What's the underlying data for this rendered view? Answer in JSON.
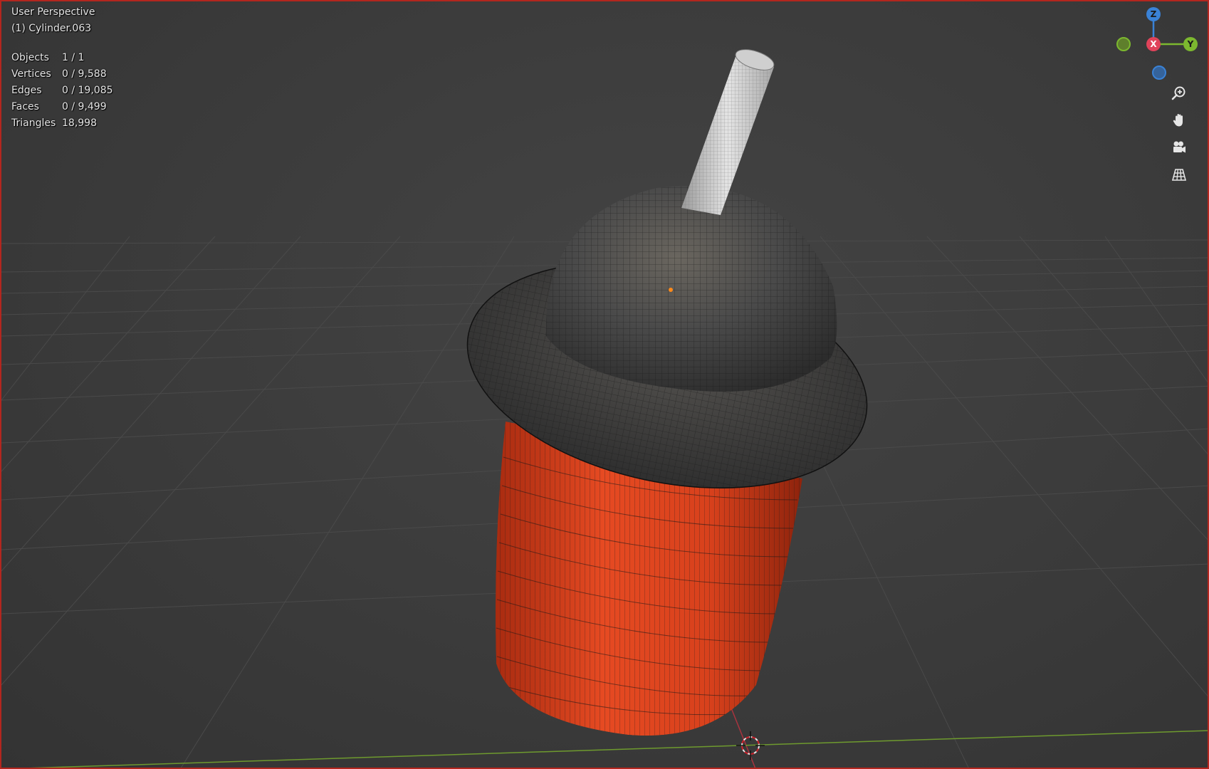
{
  "viewport": {
    "view_name": "User Perspective",
    "object_name": "(1) Cylinder.063"
  },
  "stats": {
    "rows": [
      {
        "label": "Objects",
        "value": "1 / 1"
      },
      {
        "label": "Vertices",
        "value": "0 / 9,588"
      },
      {
        "label": "Edges",
        "value": "0 / 19,085"
      },
      {
        "label": "Faces",
        "value": "0 / 9,499"
      },
      {
        "label": "Triangles",
        "value": "18,998"
      }
    ]
  },
  "gizmo": {
    "z_label": "Z",
    "y_label": "Y",
    "x_label": "X",
    "colors": {
      "x": "#e0435a",
      "y": "#7cb82f",
      "z": "#3a82d6",
      "neg_y": "#5f7f2c",
      "neg_z": "#35639b"
    }
  },
  "nav_buttons": [
    {
      "icon": "zoom-icon"
    },
    {
      "icon": "hand-pan-icon"
    },
    {
      "icon": "camera-icon"
    },
    {
      "icon": "perspective-grid-icon"
    }
  ],
  "model": {
    "cup_color": "#e0451f",
    "lid_color": "#4a4a4a",
    "straw_color": "#d8d8d8"
  }
}
